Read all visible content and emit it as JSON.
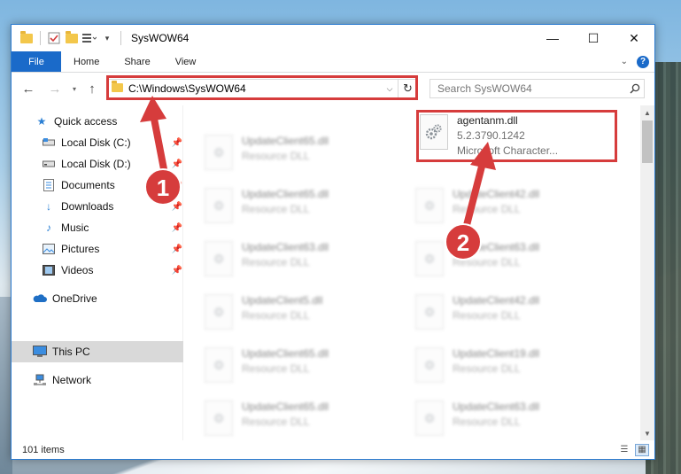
{
  "window": {
    "title": "SysWOW64",
    "controls": {
      "minimize": "—",
      "maximize": "☐",
      "close": "✕"
    }
  },
  "ribbon": {
    "tabs": [
      {
        "label": "File"
      },
      {
        "label": "Home"
      },
      {
        "label": "Share"
      },
      {
        "label": "View"
      }
    ],
    "help": "?"
  },
  "address": {
    "path": "C:\\Windows\\SysWOW64",
    "search_placeholder": "Search SysWOW64"
  },
  "sidebar": {
    "items": [
      {
        "label": "Quick access",
        "icon": "star-icon",
        "pinned": false
      },
      {
        "label": "Local Disk (C:)",
        "icon": "drive-icon",
        "pinned": true
      },
      {
        "label": "Local Disk (D:)",
        "icon": "drive-icon",
        "pinned": true
      },
      {
        "label": "Documents",
        "icon": "document-icon",
        "pinned": true
      },
      {
        "label": "Downloads",
        "icon": "download-icon",
        "pinned": true
      },
      {
        "label": "Music",
        "icon": "music-icon",
        "pinned": true
      },
      {
        "label": "Pictures",
        "icon": "picture-icon",
        "pinned": true
      },
      {
        "label": "Videos",
        "icon": "video-icon",
        "pinned": true
      },
      {
        "label": "OneDrive",
        "icon": "cloud-icon",
        "pinned": false
      },
      {
        "label": "This PC",
        "icon": "computer-icon",
        "pinned": false,
        "selected": true
      },
      {
        "label": "Network",
        "icon": "network-icon",
        "pinned": false
      }
    ]
  },
  "files": {
    "left_column": [
      {
        "name": "UpdateClient65.dll",
        "type": "Resource DLL"
      },
      {
        "name": "UpdateClient65.dll",
        "type": "Resource DLL"
      },
      {
        "name": "UpdateClient63.dll",
        "type": "Resource DLL"
      },
      {
        "name": "UpdateClient5.dll",
        "type": "Resource DLL"
      },
      {
        "name": "UpdateClient65.dll",
        "type": "Resource DLL"
      },
      {
        "name": "UpdateClient65.dll",
        "type": "Resource DLL"
      }
    ],
    "right_column": [
      {
        "name": "agentanm.dll",
        "version": "5.2.3790.1242",
        "description": "Microsoft Character...",
        "highlighted": true
      },
      {
        "name": "UpdateClient42.dll",
        "type": "Resource DLL"
      },
      {
        "name": "UpdateClient63.dll",
        "type": "Resource DLL"
      },
      {
        "name": "UpdateClient42.dll",
        "type": "Resource DLL"
      },
      {
        "name": "UpdateClient19.dll",
        "type": "Resource DLL"
      },
      {
        "name": "UpdateClient63.dll",
        "type": "Resource DLL"
      }
    ]
  },
  "status": {
    "item_count": "101 items"
  },
  "annotations": {
    "step1": "1",
    "step2": "2"
  },
  "colors": {
    "accent": "#1a6ac9",
    "highlight": "#d63c3c"
  }
}
